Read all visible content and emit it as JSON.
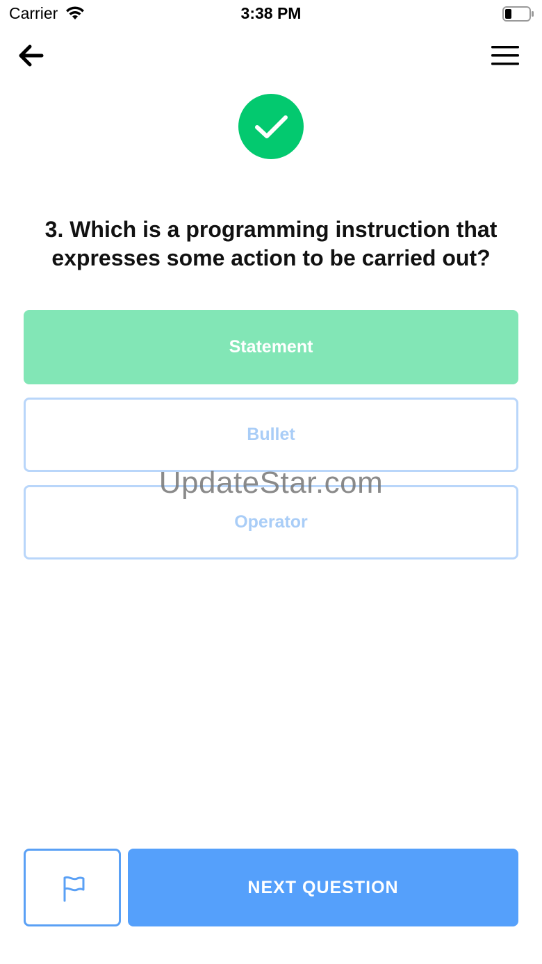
{
  "status_bar": {
    "carrier": "Carrier",
    "time": "3:38 PM"
  },
  "nav": {
    "back_icon": "arrow-left-icon",
    "menu_icon": "hamburger-menu-icon"
  },
  "result": {
    "icon": "check-circle-icon",
    "color": "#03c96f"
  },
  "question": {
    "text": "3. Which is a programming instruction that expresses some action to be carried out?"
  },
  "answers": [
    {
      "label": "Statement",
      "state": "correct"
    },
    {
      "label": "Bullet",
      "state": "neutral"
    },
    {
      "label": "Operator",
      "state": "neutral"
    }
  ],
  "watermark": "UpdateStar.com",
  "footer": {
    "flag_icon": "flag-icon",
    "next_label": "NEXT QUESTION"
  },
  "colors": {
    "correct_fill": "#82e6b6",
    "neutral_border": "#b9d6fa",
    "primary": "#55a0fb"
  }
}
